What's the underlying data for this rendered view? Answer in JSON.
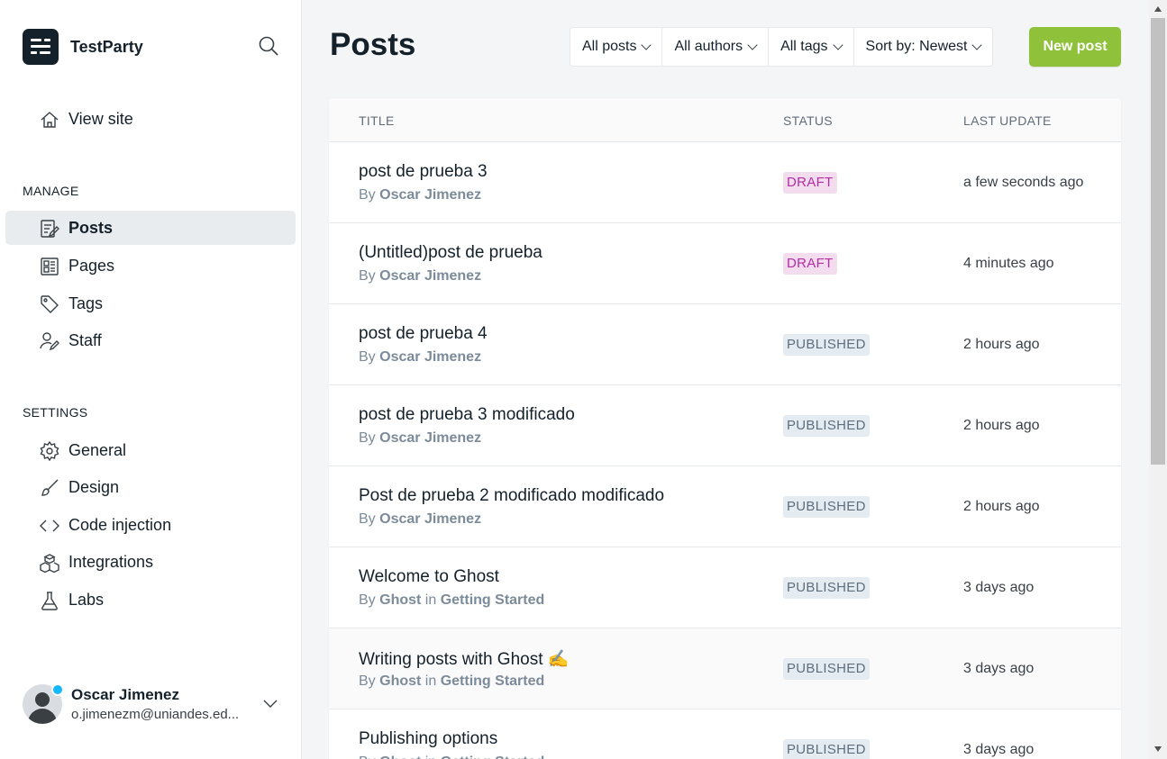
{
  "sidebar": {
    "site_title": "TestParty",
    "view_site": "View site",
    "manage_label": "MANAGE",
    "settings_label": "SETTINGS",
    "manage_items": [
      {
        "label": "Posts",
        "icon": "posts-icon"
      },
      {
        "label": "Pages",
        "icon": "pages-icon"
      },
      {
        "label": "Tags",
        "icon": "tag-icon"
      },
      {
        "label": "Staff",
        "icon": "staff-icon"
      }
    ],
    "settings_items": [
      {
        "label": "General",
        "icon": "gear-icon"
      },
      {
        "label": "Design",
        "icon": "brush-icon"
      },
      {
        "label": "Code injection",
        "icon": "code-icon"
      },
      {
        "label": "Integrations",
        "icon": "integrations-icon"
      },
      {
        "label": "Labs",
        "icon": "flask-icon"
      }
    ],
    "user": {
      "name": "Oscar Jimenez",
      "email": "o.jimenezm@uniandes.ed..."
    }
  },
  "header": {
    "title": "Posts",
    "filters": [
      "All posts",
      "All authors",
      "All tags",
      "Sort by: Newest"
    ],
    "new_post": "New post"
  },
  "table": {
    "columns": [
      "TITLE",
      "STATUS",
      "LAST UPDATE"
    ],
    "rows": [
      {
        "title": "post de prueba 3",
        "by": "By",
        "author": "Oscar Jimenez",
        "status": "DRAFT",
        "updated": "a few seconds ago"
      },
      {
        "title": "(Untitled)post de prueba",
        "by": "By",
        "author": "Oscar Jimenez",
        "status": "DRAFT",
        "updated": "4 minutes ago"
      },
      {
        "title": "post de prueba 4",
        "by": "By",
        "author": "Oscar Jimenez",
        "status": "PUBLISHED",
        "updated": "2 hours ago"
      },
      {
        "title": "post de prueba 3 modificado",
        "by": "By",
        "author": "Oscar Jimenez",
        "status": "PUBLISHED",
        "updated": "2 hours ago"
      },
      {
        "title": "Post de prueba 2 modificado modificado",
        "by": "By",
        "author": "Oscar Jimenez",
        "status": "PUBLISHED",
        "updated": "2 hours ago"
      },
      {
        "title": "Welcome to Ghost",
        "by": "By",
        "author": "Ghost",
        "in": "in",
        "tag": "Getting Started",
        "status": "PUBLISHED",
        "updated": "3 days ago"
      },
      {
        "title": "Writing posts with Ghost ✍️",
        "by": "By",
        "author": "Ghost",
        "in": "in",
        "tag": "Getting Started",
        "status": "PUBLISHED",
        "updated": "3 days ago"
      },
      {
        "title": "Publishing options",
        "by": "By",
        "author": "Ghost",
        "in": "in",
        "tag": "Getting Started",
        "status": "PUBLISHED",
        "updated": "3 days ago"
      }
    ]
  },
  "colors": {
    "accent_green": "#8fc13a",
    "draft_bg": "#f4dcef",
    "draft_text": "#b22ea3",
    "published_bg": "#e4ebf1",
    "published_text": "#5d6f7e"
  }
}
